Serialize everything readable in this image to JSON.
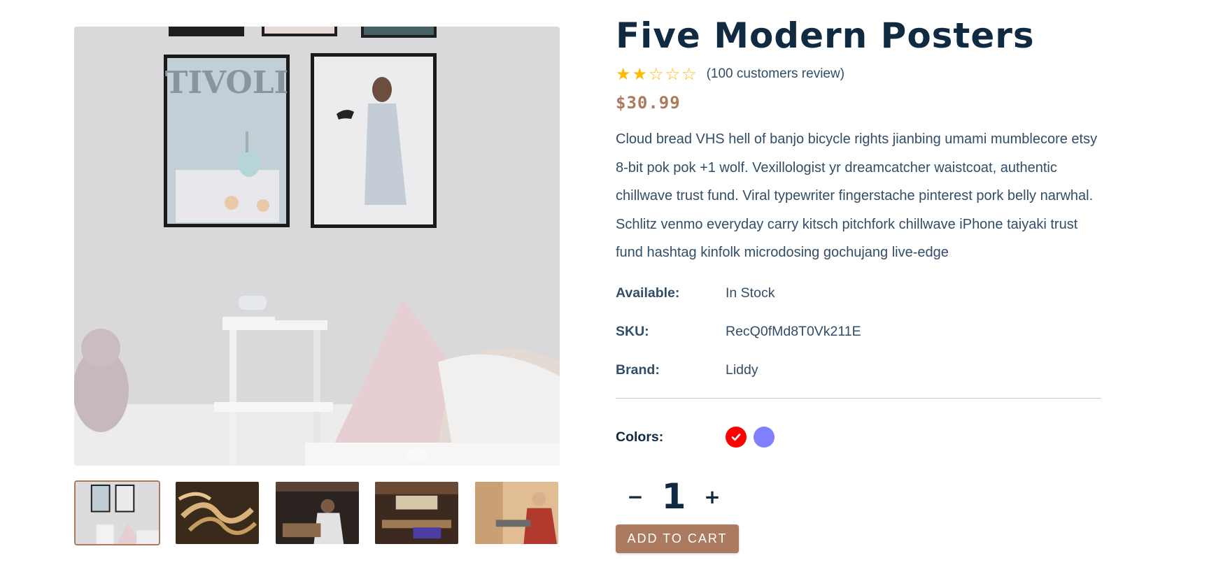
{
  "product": {
    "title": "Five Modern Posters",
    "rating": 2,
    "rating_max": 5,
    "reviews_text": "(100 customers review)",
    "price": "$30.99",
    "description": "Cloud bread VHS hell of banjo bicycle rights jianbing umami mumblecore etsy 8-bit pok pok +1 wolf. Vexillologist yr dreamcatcher waistcoat, authentic chillwave trust fund. Viral typewriter fingerstache pinterest pork belly narwhal. Schlitz venmo everyday carry kitsch pitchfork chillwave iPhone taiyaki trust fund hashtag kinfolk microdosing gochujang live-edge"
  },
  "meta": {
    "available_label": "Available:",
    "available_value": "In Stock",
    "sku_label": "SKU:",
    "sku_value": "RecQ0fMd8T0Vk211E",
    "brand_label": "Brand:",
    "brand_value": "Liddy"
  },
  "colors": {
    "label": "Colors:",
    "options": [
      "#ff0000",
      "#8080ff"
    ],
    "selected_index": 0
  },
  "quantity": {
    "minus_symbol": "−",
    "value": "1",
    "plus_symbol": "+"
  },
  "cart": {
    "button_label": "Add to cart"
  },
  "gallery": {
    "main_image": "living room with framed posters",
    "thumbnails": [
      "posters-room",
      "wood-shavings",
      "woodworker",
      "workshop",
      "carpenter"
    ],
    "active_index": 0
  },
  "theme": {
    "accent": "#ab7a5f",
    "heading": "#102a42",
    "text": "#324d67",
    "star": "#ffb900"
  }
}
